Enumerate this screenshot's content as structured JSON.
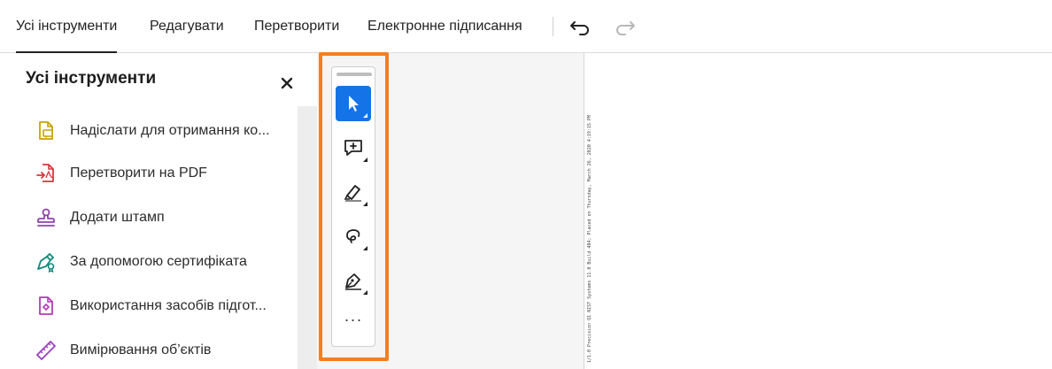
{
  "menu": {
    "tabs": [
      {
        "label": "Усі інструменти"
      },
      {
        "label": "Редагувати"
      },
      {
        "label": "Перетворити"
      },
      {
        "label": "Електронне підписання"
      }
    ]
  },
  "panel": {
    "title": "Усі інструменти",
    "close_symbol": "×",
    "items": [
      {
        "label": "Надіслати для отримання ко...",
        "icon": "send-for-comments-icon",
        "color": "#c9a200"
      },
      {
        "label": "Перетворити на PDF",
        "icon": "convert-to-pdf-icon",
        "color": "#d7373f"
      },
      {
        "label": "Додати штамп",
        "icon": "stamp-icon",
        "color": "#8e44ad"
      },
      {
        "label": "За допомогою сертифіката",
        "icon": "certificate-pen-icon",
        "color": "#0f8a7a"
      },
      {
        "label": "Використання засобів підгот...",
        "icon": "prepare-form-icon",
        "color": "#b23ab8"
      },
      {
        "label": "Вимірювання об’єктів",
        "icon": "ruler-icon",
        "color": "#9b3fbf"
      }
    ]
  },
  "quick_toolbar": {
    "tools": [
      "select-cursor-icon",
      "add-comment-icon",
      "highlighter-icon",
      "lasso-icon",
      "draw-pen-icon"
    ],
    "more_label": "···",
    "accent": "#1473e6",
    "frame_color": "#f47f20"
  },
  "document": {
    "vertical_text": "1/1.0 Precision Q1 NIST Systems 11.0 Build 404; Placed on Thursday, March 26, 2020 4:19:15 PM"
  }
}
